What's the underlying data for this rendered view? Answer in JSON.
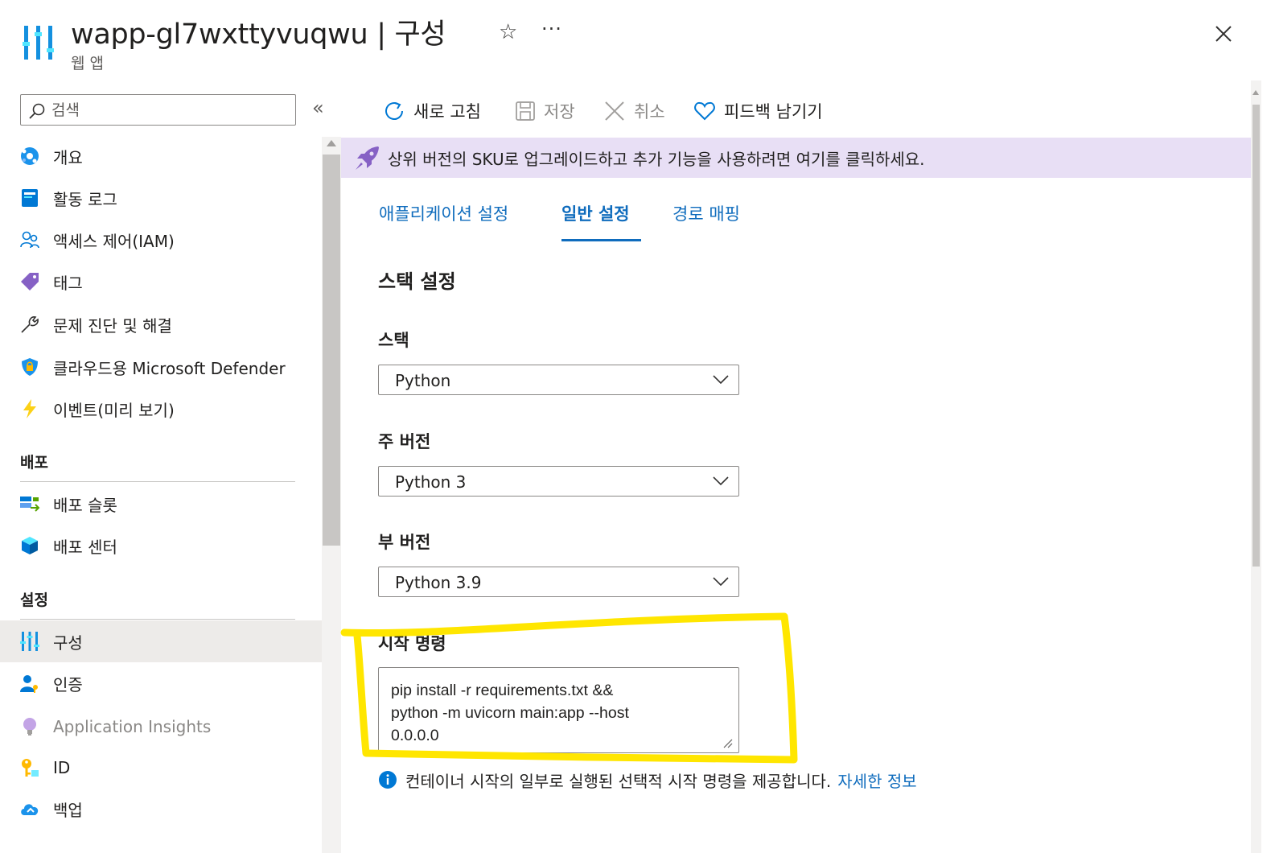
{
  "header": {
    "title": "wapp-gl7wxttyvuqwu | 구성",
    "subtitle": "웹 앱",
    "star_icon": "☆",
    "more_icon": "···"
  },
  "sidebar": {
    "search_placeholder": "검색",
    "collapse_icon": "«",
    "items": [
      {
        "label": "개요",
        "icon": "globe-icon"
      },
      {
        "label": "활동 로그",
        "icon": "activity-log-icon"
      },
      {
        "label": "액세스 제어(IAM)",
        "icon": "people-icon"
      },
      {
        "label": "태그",
        "icon": "tag-icon"
      },
      {
        "label": "문제 진단 및 해결",
        "icon": "wrench-icon"
      },
      {
        "label": "클라우드용 Microsoft Defender",
        "icon": "shield-icon"
      },
      {
        "label": "이벤트(미리 보기)",
        "icon": "lightning-icon"
      }
    ],
    "sections": [
      {
        "title": "배포",
        "items": [
          {
            "label": "배포 슬롯",
            "icon": "deployment-slots-icon"
          },
          {
            "label": "배포 센터",
            "icon": "cube-icon"
          }
        ]
      },
      {
        "title": "설정",
        "items": [
          {
            "label": "구성",
            "icon": "configuration-icon",
            "selected": true
          },
          {
            "label": "인증",
            "icon": "user-key-icon"
          },
          {
            "label": "Application Insights",
            "icon": "lightbulb-icon",
            "disabled": true
          },
          {
            "label": "ID",
            "icon": "key-icon"
          },
          {
            "label": "백업",
            "icon": "cloud-backup-icon"
          }
        ]
      }
    ]
  },
  "toolbar": {
    "refresh": "새로 고침",
    "save": "저장",
    "discard": "취소",
    "feedback": "피드백 남기기"
  },
  "banner": {
    "text": "상위 버전의 SKU로 업그레이드하고 추가 기능을 사용하려면 여기를 클릭하세요."
  },
  "tabs": [
    {
      "label": "애플리케이션 설정"
    },
    {
      "label": "일반 설정",
      "active": true
    },
    {
      "label": "경로 매핑"
    }
  ],
  "stack_settings": {
    "title": "스택 설정",
    "stack_label": "스택",
    "stack_value": "Python",
    "major_label": "주 버전",
    "major_value": "Python 3",
    "minor_label": "부 버전",
    "minor_value": "Python 3.9",
    "startup_label": "시작 명령",
    "startup_value": "pip install -r requirements.txt &&\npython -m uvicorn main:app --host\n0.0.0.0",
    "info_text": "컨테이너 시작의 일부로 실행된 선택적 시작 명령을 제공합니다.",
    "info_link": "자세한 정보"
  },
  "colors": {
    "accent": "#0f6cbd",
    "banner_bg": "#e8dff5",
    "highlight": "#ffe600",
    "selected_bg": "#edebe9"
  }
}
